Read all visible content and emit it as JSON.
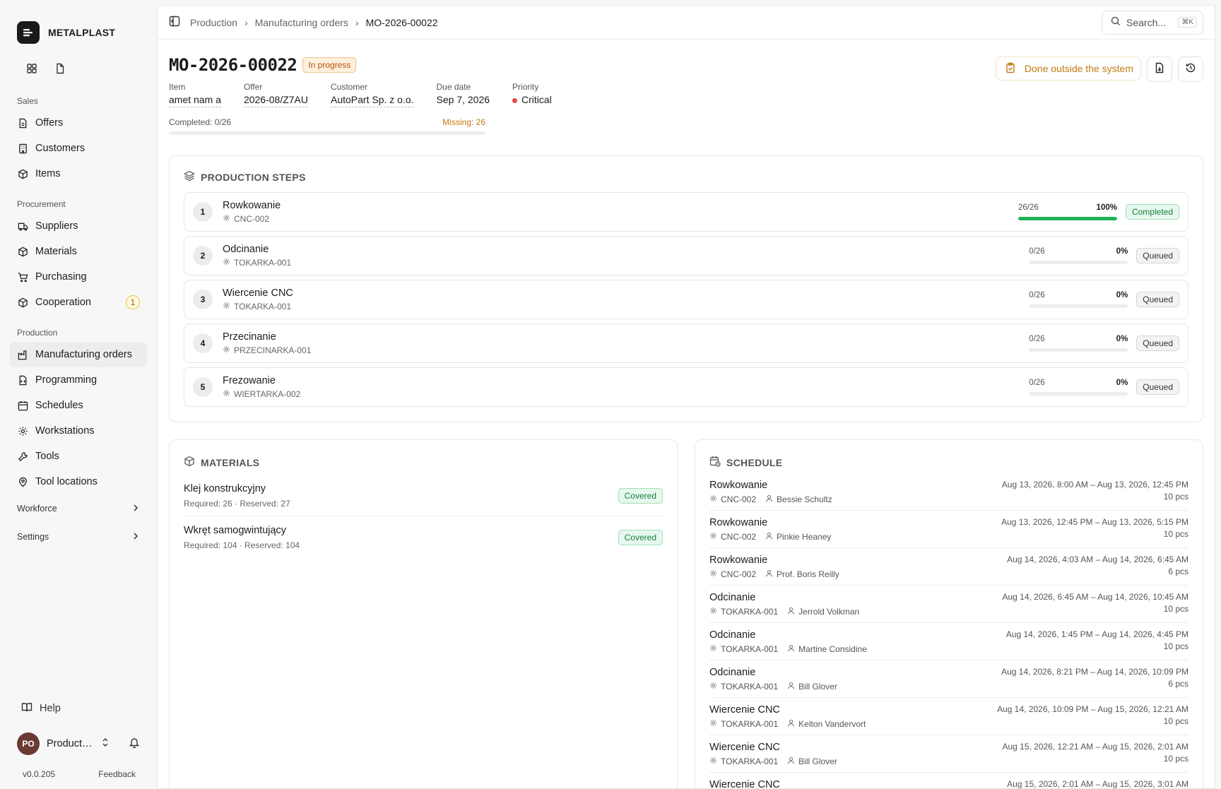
{
  "brand": {
    "name": "METALPLAST"
  },
  "sidebar": {
    "sections": [
      {
        "label": "Sales",
        "items": [
          {
            "label": "Offers",
            "icon": "document-icon"
          },
          {
            "label": "Customers",
            "icon": "building-icon"
          },
          {
            "label": "Items",
            "icon": "box-icon"
          }
        ]
      },
      {
        "label": "Procurement",
        "items": [
          {
            "label": "Suppliers",
            "icon": "truck-icon"
          },
          {
            "label": "Materials",
            "icon": "box-icon"
          },
          {
            "label": "Purchasing",
            "icon": "cart-icon"
          },
          {
            "label": "Cooperation",
            "icon": "box-icon",
            "badge": "1"
          }
        ]
      },
      {
        "label": "Production",
        "items": [
          {
            "label": "Manufacturing orders",
            "icon": "factory-icon",
            "active": true
          },
          {
            "label": "Programming",
            "icon": "file-code-icon"
          },
          {
            "label": "Schedules",
            "icon": "calendar-icon"
          },
          {
            "label": "Workstations",
            "icon": "cog-icon"
          },
          {
            "label": "Tools",
            "icon": "wrench-icon"
          },
          {
            "label": "Tool locations",
            "icon": "pin-icon"
          }
        ]
      }
    ],
    "collapsibles": [
      "Workforce",
      "Settings"
    ],
    "help": "Help",
    "user": {
      "initials": "PO",
      "name": "Production Officer"
    },
    "version": "v0.0.205",
    "feedback": "Feedback"
  },
  "topbar": {
    "breadcrumbs": [
      "Production",
      "Manufacturing orders",
      "MO-2026-00022"
    ],
    "search_placeholder": "Search...",
    "search_shortcut": "⌘K"
  },
  "order": {
    "number": "MO-2026-00022",
    "status": "In progress",
    "done_outside_label": "Done outside the system",
    "meta": [
      {
        "key": "Item",
        "value": "amet nam a"
      },
      {
        "key": "Offer",
        "value": "2026-08/Z7AU"
      },
      {
        "key": "Customer",
        "value": "AutoPart Sp. z o.o."
      },
      {
        "key": "Due date",
        "value": "Sep 7, 2026"
      },
      {
        "key": "Priority",
        "value": "Critical"
      }
    ],
    "completed_label": "Completed: 0/26",
    "missing_label": "Missing: 26",
    "completed_fraction": 0
  },
  "steps": {
    "title": "PRODUCTION STEPS",
    "items": [
      {
        "num": "1",
        "name": "Rowkowanie",
        "machine": "CNC-002",
        "count": "26/26",
        "pct": "100%",
        "fraction": 1.0,
        "status": "Completed"
      },
      {
        "num": "2",
        "name": "Odcinanie",
        "machine": "TOKARKA-001",
        "count": "0/26",
        "pct": "0%",
        "fraction": 0,
        "status": "Queued"
      },
      {
        "num": "3",
        "name": "Wiercenie CNC",
        "machine": "TOKARKA-001",
        "count": "0/26",
        "pct": "0%",
        "fraction": 0,
        "status": "Queued"
      },
      {
        "num": "4",
        "name": "Przecinanie",
        "machine": "PRZECINARKA-001",
        "count": "0/26",
        "pct": "0%",
        "fraction": 0,
        "status": "Queued"
      },
      {
        "num": "5",
        "name": "Frezowanie",
        "machine": "WIERTARKA-002",
        "count": "0/26",
        "pct": "0%",
        "fraction": 0,
        "status": "Queued"
      }
    ]
  },
  "materials": {
    "title": "MATERIALS",
    "items": [
      {
        "name": "Klej konstrukcyjny",
        "detail": "Required: 26 · Reserved: 27",
        "status": "Covered"
      },
      {
        "name": "Wkręt samogwintujący",
        "detail": "Required: 104 · Reserved: 104",
        "status": "Covered"
      }
    ]
  },
  "schedule": {
    "title": "SCHEDULE",
    "items": [
      {
        "step": "Rowkowanie",
        "machine": "CNC-002",
        "worker": "Bessie Schultz",
        "range": "Aug 13, 2026, 8:00 AM – Aug 13, 2026, 12:45 PM",
        "qty": "10 pcs"
      },
      {
        "step": "Rowkowanie",
        "machine": "CNC-002",
        "worker": "Pinkie Heaney",
        "range": "Aug 13, 2026, 12:45 PM – Aug 13, 2026, 5:15 PM",
        "qty": "10 pcs"
      },
      {
        "step": "Rowkowanie",
        "machine": "CNC-002",
        "worker": "Prof. Boris Reilly",
        "range": "Aug 14, 2026, 4:03 AM – Aug 14, 2026, 6:45 AM",
        "qty": "6 pcs"
      },
      {
        "step": "Odcinanie",
        "machine": "TOKARKA-001",
        "worker": "Jerrold Volkman",
        "range": "Aug 14, 2026, 6:45 AM – Aug 14, 2026, 10:45 AM",
        "qty": "10 pcs"
      },
      {
        "step": "Odcinanie",
        "machine": "TOKARKA-001",
        "worker": "Martine Considine",
        "range": "Aug 14, 2026, 1:45 PM – Aug 14, 2026, 4:45 PM",
        "qty": "10 pcs"
      },
      {
        "step": "Odcinanie",
        "machine": "TOKARKA-001",
        "worker": "Bill Glover",
        "range": "Aug 14, 2026, 8:21 PM – Aug 14, 2026, 10:09 PM",
        "qty": "6 pcs"
      },
      {
        "step": "Wiercenie CNC",
        "machine": "TOKARKA-001",
        "worker": "Kelton Vandervort",
        "range": "Aug 14, 2026, 10:09 PM – Aug 15, 2026, 12:21 AM",
        "qty": "10 pcs"
      },
      {
        "step": "Wiercenie CNC",
        "machine": "TOKARKA-001",
        "worker": "Bill Glover",
        "range": "Aug 15, 2026, 12:21 AM – Aug 15, 2026, 2:01 AM",
        "qty": "10 pcs"
      },
      {
        "step": "Wiercenie CNC",
        "machine": "",
        "worker": "",
        "range": "Aug 15, 2026, 2:01 AM – Aug 15, 2026, 3:01 AM",
        "qty": ""
      }
    ]
  },
  "colors": {
    "accent_green": "#1fb556",
    "amber": "#c27a0e",
    "critical": "#e5484d"
  }
}
